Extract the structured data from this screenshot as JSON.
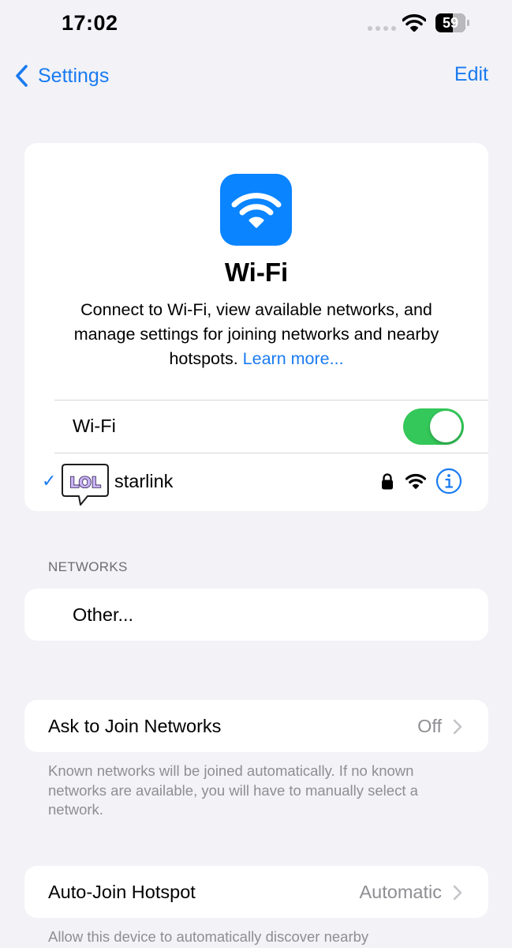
{
  "status_bar": {
    "time": "17:02",
    "battery": "59"
  },
  "nav": {
    "back_label": "Settings",
    "edit_label": "Edit"
  },
  "wifi_card": {
    "icon": "wifi-icon",
    "title": "Wi-Fi",
    "description": "Connect to Wi-Fi, view available networks, and manage settings for joining networks and nearby hotspots.",
    "learn_more": "Learn more...",
    "toggle_label": "Wi-Fi",
    "toggle_on": true,
    "connected_network": {
      "name": "starlink",
      "secured": true,
      "sticker_text": "LOL"
    }
  },
  "networks": {
    "header": "NETWORKS",
    "other_label": "Other..."
  },
  "ask_to_join": {
    "label": "Ask to Join Networks",
    "value": "Off",
    "footnote": "Known networks will be joined automatically. If no known networks are available, you will have to manually select a network."
  },
  "auto_join_hotspot": {
    "label": "Auto-Join Hotspot",
    "value": "Automatic",
    "footnote": "Allow this device to automatically discover nearby"
  },
  "colors": {
    "accent": "#1a7bf0",
    "toggle_on": "#34c759",
    "wifi_icon_bg": "#0a84ff",
    "background": "#f2f2f7"
  }
}
